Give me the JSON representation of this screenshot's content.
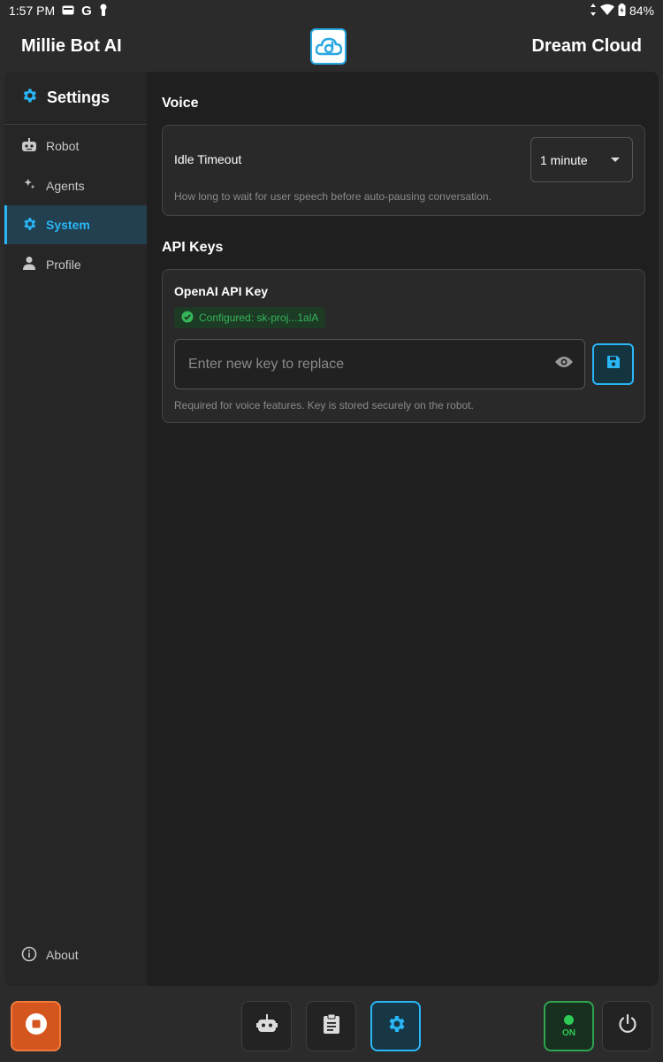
{
  "status_bar": {
    "time": "1:57 PM",
    "g_label": "G",
    "battery": "84%"
  },
  "app_bar": {
    "title": "Millie Bot AI",
    "brand": "Dream Cloud",
    "logo_icon": "dream-cloud-logo"
  },
  "sidebar": {
    "header": "Settings",
    "items": [
      {
        "label": "Robot",
        "icon": "robot-icon",
        "active": false
      },
      {
        "label": "Agents",
        "icon": "agents-icon",
        "active": false
      },
      {
        "label": "System",
        "icon": "gear-icon",
        "active": true
      },
      {
        "label": "Profile",
        "icon": "person-icon",
        "active": false
      }
    ],
    "about": "About"
  },
  "voice": {
    "section_title": "Voice",
    "idle_label": "Idle Timeout",
    "idle_value": "1 minute",
    "idle_help": "How long to wait for user speech before auto-pausing conversation."
  },
  "api_keys": {
    "section_title": "API Keys",
    "openai_label": "OpenAI API Key",
    "status": "Configured: sk-proj...1alA",
    "input_value": "",
    "input_placeholder": "Enter new key to replace",
    "help": "Required for voice features. Key is stored securely on the robot."
  },
  "bottom_bar": {
    "on_label": "ON"
  },
  "colors": {
    "accent": "#29b6f6",
    "stop": "#d4561e",
    "ok_green": "#2ecc55",
    "panel": "#1f1f1f"
  }
}
